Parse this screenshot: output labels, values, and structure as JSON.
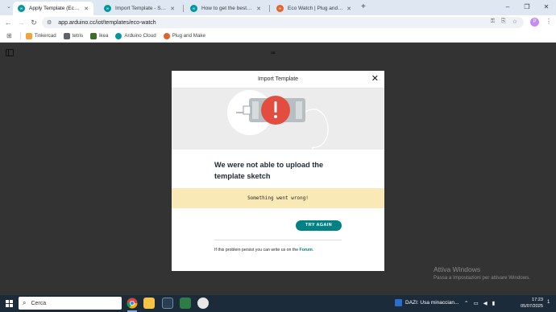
{
  "browser": {
    "tabs": [
      {
        "title": "Apply Template (Eco Watch) | A",
        "icon": "arduino",
        "active": true
      },
      {
        "title": "Import Template - Something w",
        "icon": "arduino",
        "active": false
      },
      {
        "title": "How to get the best out of this",
        "icon": "arduino",
        "active": false
      },
      {
        "title": "Eco Watch | Plug and Make",
        "icon": "plug-and-make",
        "active": false
      }
    ],
    "new_tab": "+",
    "window_controls": {
      "minimize": "–",
      "maximize": "❐",
      "close": "✕"
    },
    "url": "app.arduino.cc/iot/templates/eco-watch",
    "profile_initial": "P",
    "bookmarks": [
      {
        "label": "Tinkercad",
        "color": "#f0a33a"
      },
      {
        "label": "tetris",
        "color": "#5f6368"
      },
      {
        "label": "ikea",
        "color": "#3c6e2a"
      },
      {
        "label": "Arduino Cloud",
        "color": "#00979d"
      },
      {
        "label": "Plug and Make",
        "color": "#e3642a"
      }
    ]
  },
  "page": {
    "logo": "∞"
  },
  "modal": {
    "title": "Import Template",
    "close": "✕",
    "heading": "We were not able to upload the template sketch",
    "error_message": "Something went wrong!",
    "retry_label": "TRY AGAIN",
    "help_text": "If this problem persist you can write us on the",
    "help_link": "Forum",
    "help_suffix": "."
  },
  "watermark": {
    "line1": "Attiva Windows",
    "line2": "Passa a Impostazioni per attivare Windows."
  },
  "taskbar": {
    "search_placeholder": "Cerca",
    "news": "DAZI: Usa minaccian...",
    "time": "17:23",
    "date": "05/07/2025",
    "notification_count": "1"
  },
  "colors": {
    "accent": "#008184",
    "error_red": "#e34d3f",
    "warning_bg": "#f8e9b6"
  }
}
